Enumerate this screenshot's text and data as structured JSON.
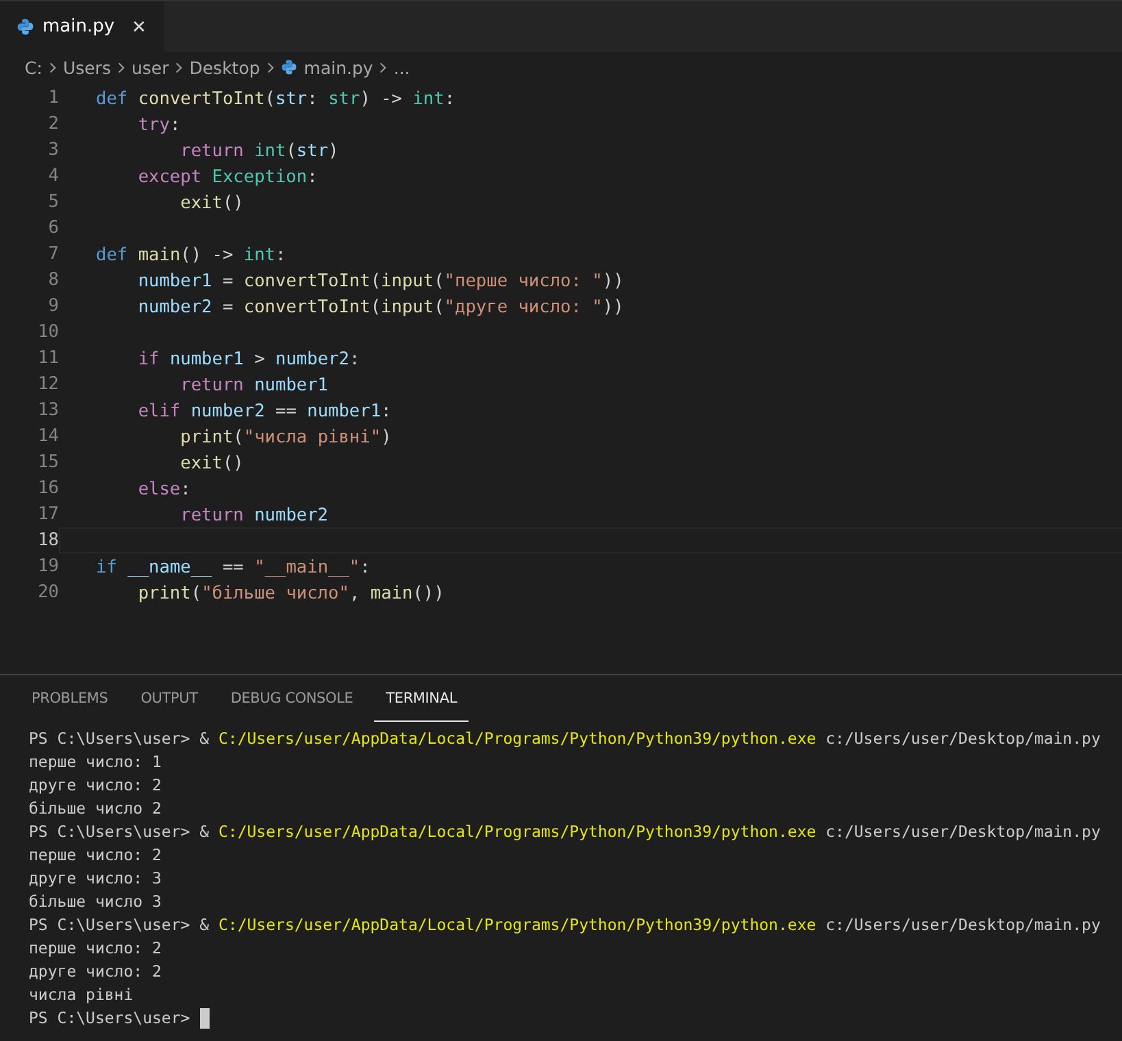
{
  "tab": {
    "label": "main.py",
    "close": "✕",
    "selected": true
  },
  "breadcrumb": [
    "C:",
    "Users",
    "user",
    "Desktop",
    "main.py",
    "..."
  ],
  "code": [
    {
      "number": "1",
      "current": false,
      "tokens": [
        {
          "kind": "def",
          "text": "def"
        },
        {
          "kind": "fn",
          "text": " convertToInt"
        },
        {
          "kind": "plain",
          "text": "("
        },
        {
          "kind": "var",
          "text": "str"
        },
        {
          "kind": "plain",
          "text": ":"
        },
        {
          "kind": "type",
          "text": " str"
        },
        {
          "kind": "plain",
          "text": ") -> "
        },
        {
          "kind": "type",
          "text": "int"
        },
        {
          "kind": "plain",
          "text": ":"
        }
      ]
    },
    {
      "number": "2",
      "current": false,
      "tokens": [
        {
          "kind": "kw",
          "text": "    try"
        },
        {
          "kind": "plain",
          "text": ":"
        }
      ]
    },
    {
      "number": "3",
      "current": false,
      "tokens": [
        {
          "kind": "kw",
          "text": "        return"
        },
        {
          "kind": "type",
          "text": " int"
        },
        {
          "kind": "plain",
          "text": "("
        },
        {
          "kind": "var",
          "text": "str"
        },
        {
          "kind": "plain",
          "text": ")"
        }
      ]
    },
    {
      "number": "4",
      "current": false,
      "tokens": [
        {
          "kind": "kw",
          "text": "    except"
        },
        {
          "kind": "type",
          "text": " Exception"
        },
        {
          "kind": "plain",
          "text": ":"
        }
      ]
    },
    {
      "number": "5",
      "current": false,
      "tokens": [
        {
          "kind": "fn",
          "text": "        exit"
        },
        {
          "kind": "plain",
          "text": "()"
        }
      ]
    },
    {
      "number": "6",
      "current": false
    },
    {
      "number": "7",
      "current": false,
      "tokens": [
        {
          "kind": "def",
          "text": "def"
        },
        {
          "kind": "fn",
          "text": " main"
        },
        {
          "kind": "plain",
          "text": "() -> "
        },
        {
          "kind": "type",
          "text": "int"
        },
        {
          "kind": "plain",
          "text": ":"
        }
      ]
    },
    {
      "number": "8",
      "current": false,
      "tokens": [
        {
          "kind": "var",
          "text": "    number1"
        },
        {
          "kind": "plain",
          "text": " = "
        },
        {
          "kind": "fn",
          "text": "convertToInt"
        },
        {
          "kind": "plain",
          "text": "("
        },
        {
          "kind": "fn",
          "text": "input"
        },
        {
          "kind": "plain",
          "text": "("
        },
        {
          "kind": "str",
          "text": "\"перше число: \""
        },
        {
          "kind": "plain",
          "text": "))"
        }
      ]
    },
    {
      "number": "9",
      "current": false,
      "tokens": [
        {
          "kind": "var",
          "text": "    number2"
        },
        {
          "kind": "plain",
          "text": " = "
        },
        {
          "kind": "fn",
          "text": "convertToInt"
        },
        {
          "kind": "plain",
          "text": "("
        },
        {
          "kind": "fn",
          "text": "input"
        },
        {
          "kind": "plain",
          "text": "("
        },
        {
          "kind": "str",
          "text": "\"друге число: \""
        },
        {
          "kind": "plain",
          "text": "))"
        }
      ]
    },
    {
      "number": "10",
      "current": false
    },
    {
      "number": "11",
      "current": false,
      "tokens": [
        {
          "kind": "kw",
          "text": "    if"
        },
        {
          "kind": "var",
          "text": " number1"
        },
        {
          "kind": "plain",
          "text": " > "
        },
        {
          "kind": "var",
          "text": "number2"
        },
        {
          "kind": "plain",
          "text": ":"
        }
      ]
    },
    {
      "number": "12",
      "current": false,
      "tokens": [
        {
          "kind": "kw",
          "text": "        return"
        },
        {
          "kind": "var",
          "text": " number1"
        }
      ]
    },
    {
      "number": "13",
      "current": false,
      "tokens": [
        {
          "kind": "kw",
          "text": "    elif"
        },
        {
          "kind": "var",
          "text": " number2"
        },
        {
          "kind": "plain",
          "text": " == "
        },
        {
          "kind": "var",
          "text": "number1"
        },
        {
          "kind": "plain",
          "text": ":"
        }
      ]
    },
    {
      "number": "14",
      "current": false,
      "tokens": [
        {
          "kind": "fn",
          "text": "        print"
        },
        {
          "kind": "plain",
          "text": "("
        },
        {
          "kind": "str",
          "text": "\"числа рівні\""
        },
        {
          "kind": "plain",
          "text": ")"
        }
      ]
    },
    {
      "number": "15",
      "current": false,
      "tokens": [
        {
          "kind": "fn",
          "text": "        exit"
        },
        {
          "kind": "plain",
          "text": "()"
        }
      ]
    },
    {
      "number": "16",
      "current": false,
      "tokens": [
        {
          "kind": "kw",
          "text": "    else"
        },
        {
          "kind": "plain",
          "text": ":"
        }
      ]
    },
    {
      "number": "17",
      "current": false,
      "tokens": [
        {
          "kind": "kw",
          "text": "        return"
        },
        {
          "kind": "var",
          "text": " number2"
        }
      ]
    },
    {
      "number": "18",
      "current": true
    },
    {
      "number": "19",
      "current": false,
      "tokens": [
        {
          "kind": "def",
          "text": "if"
        },
        {
          "kind": "var",
          "text": " __name__"
        },
        {
          "kind": "plain",
          "text": " == "
        },
        {
          "kind": "str",
          "text": "\"__main__\""
        },
        {
          "kind": "plain",
          "text": ":"
        }
      ]
    },
    {
      "number": "20",
      "current": false,
      "tokens": [
        {
          "kind": "fn",
          "text": "    print"
        },
        {
          "kind": "plain",
          "text": "("
        },
        {
          "kind": "str",
          "text": "\"більше число\""
        },
        {
          "kind": "plain",
          "text": ", "
        },
        {
          "kind": "fn",
          "text": "main"
        },
        {
          "kind": "plain",
          "text": "())"
        }
      ]
    }
  ],
  "panel_tabs": [
    {
      "label": "PROBLEMS",
      "selected": false
    },
    {
      "label": "OUTPUT",
      "selected": false
    },
    {
      "label": "DEBUG CONSOLE",
      "selected": false
    },
    {
      "label": "TERMINAL",
      "selected": true
    }
  ],
  "terminal": {
    "cursor": true,
    "lines": [
      [
        {
          "kind": "plain",
          "text": "PS C:\\Users\\user> & "
        },
        {
          "kind": "path",
          "text": "C:/Users/user/AppData/Local/Programs/Python/Python39/python.exe"
        },
        {
          "kind": "plain",
          "text": " c:/Users/user/Desktop/main.py"
        }
      ],
      [
        {
          "kind": "plain",
          "text": "перше число: 1"
        }
      ],
      [
        {
          "kind": "plain",
          "text": "друге число: 2"
        }
      ],
      [
        {
          "kind": "plain",
          "text": "більше число 2"
        }
      ],
      [
        {
          "kind": "plain",
          "text": "PS C:\\Users\\user> & "
        },
        {
          "kind": "path",
          "text": "C:/Users/user/AppData/Local/Programs/Python/Python39/python.exe"
        },
        {
          "kind": "plain",
          "text": " c:/Users/user/Desktop/main.py"
        }
      ],
      [
        {
          "kind": "plain",
          "text": "перше число: 2"
        }
      ],
      [
        {
          "kind": "plain",
          "text": "друге число: 3"
        }
      ],
      [
        {
          "kind": "plain",
          "text": "більше число 3"
        }
      ],
      [
        {
          "kind": "plain",
          "text": "PS C:\\Users\\user> & "
        },
        {
          "kind": "path",
          "text": "C:/Users/user/AppData/Local/Programs/Python/Python39/python.exe"
        },
        {
          "kind": "plain",
          "text": " c:/Users/user/Desktop/main.py"
        }
      ],
      [
        {
          "kind": "plain",
          "text": "перше число: 2"
        }
      ],
      [
        {
          "kind": "plain",
          "text": "друге число: 2"
        }
      ],
      [
        {
          "kind": "plain",
          "text": "числа рівні"
        }
      ],
      [
        {
          "kind": "plain",
          "text": "PS C:\\Users\\user>"
        }
      ]
    ]
  }
}
